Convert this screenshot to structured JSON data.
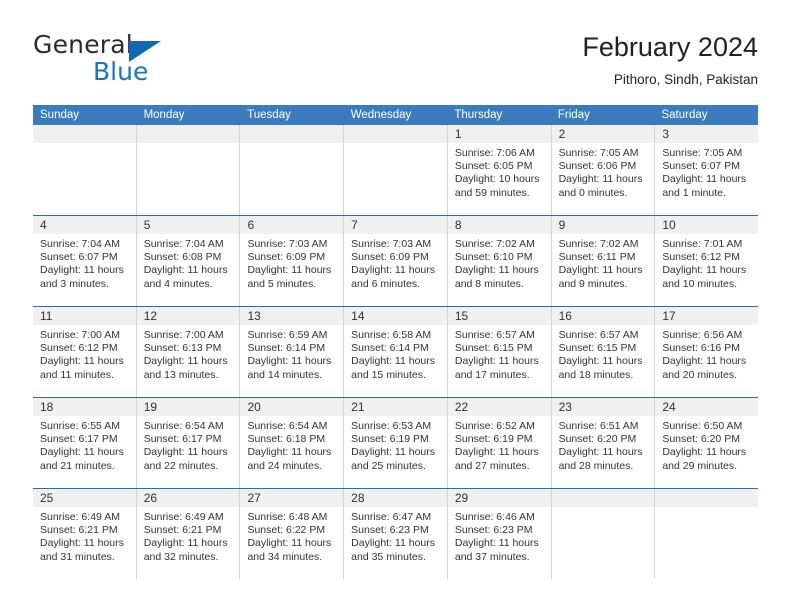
{
  "logo": {
    "word_top": "General",
    "word_bottom": "Blue",
    "triangle_color": "#1268b3",
    "blue_color": "#1b75bb"
  },
  "header": {
    "title": "February 2024",
    "location": "Pithoro, Sindh, Pakistan"
  },
  "theme": {
    "header_blue": "#3a7cbe",
    "rule_blue": "#2e6da4",
    "daynum_band": "#f0f0f0",
    "cell_border": "#d4d4d4"
  },
  "calendar": {
    "weekday_headers": [
      "Sunday",
      "Monday",
      "Tuesday",
      "Wednesday",
      "Thursday",
      "Friday",
      "Saturday"
    ],
    "weeks": [
      [
        {
          "day": "",
          "sunrise": "",
          "sunset": "",
          "daylight_line1": "",
          "daylight_line2": ""
        },
        {
          "day": "",
          "sunrise": "",
          "sunset": "",
          "daylight_line1": "",
          "daylight_line2": ""
        },
        {
          "day": "",
          "sunrise": "",
          "sunset": "",
          "daylight_line1": "",
          "daylight_line2": ""
        },
        {
          "day": "",
          "sunrise": "",
          "sunset": "",
          "daylight_line1": "",
          "daylight_line2": ""
        },
        {
          "day": "1",
          "sunrise": "Sunrise: 7:06 AM",
          "sunset": "Sunset: 6:05 PM",
          "daylight_line1": "Daylight: 10 hours",
          "daylight_line2": "and 59 minutes."
        },
        {
          "day": "2",
          "sunrise": "Sunrise: 7:05 AM",
          "sunset": "Sunset: 6:06 PM",
          "daylight_line1": "Daylight: 11 hours",
          "daylight_line2": "and 0 minutes."
        },
        {
          "day": "3",
          "sunrise": "Sunrise: 7:05 AM",
          "sunset": "Sunset: 6:07 PM",
          "daylight_line1": "Daylight: 11 hours",
          "daylight_line2": "and 1 minute."
        }
      ],
      [
        {
          "day": "4",
          "sunrise": "Sunrise: 7:04 AM",
          "sunset": "Sunset: 6:07 PM",
          "daylight_line1": "Daylight: 11 hours",
          "daylight_line2": "and 3 minutes."
        },
        {
          "day": "5",
          "sunrise": "Sunrise: 7:04 AM",
          "sunset": "Sunset: 6:08 PM",
          "daylight_line1": "Daylight: 11 hours",
          "daylight_line2": "and 4 minutes."
        },
        {
          "day": "6",
          "sunrise": "Sunrise: 7:03 AM",
          "sunset": "Sunset: 6:09 PM",
          "daylight_line1": "Daylight: 11 hours",
          "daylight_line2": "and 5 minutes."
        },
        {
          "day": "7",
          "sunrise": "Sunrise: 7:03 AM",
          "sunset": "Sunset: 6:09 PM",
          "daylight_line1": "Daylight: 11 hours",
          "daylight_line2": "and 6 minutes."
        },
        {
          "day": "8",
          "sunrise": "Sunrise: 7:02 AM",
          "sunset": "Sunset: 6:10 PM",
          "daylight_line1": "Daylight: 11 hours",
          "daylight_line2": "and 8 minutes."
        },
        {
          "day": "9",
          "sunrise": "Sunrise: 7:02 AM",
          "sunset": "Sunset: 6:11 PM",
          "daylight_line1": "Daylight: 11 hours",
          "daylight_line2": "and 9 minutes."
        },
        {
          "day": "10",
          "sunrise": "Sunrise: 7:01 AM",
          "sunset": "Sunset: 6:12 PM",
          "daylight_line1": "Daylight: 11 hours",
          "daylight_line2": "and 10 minutes."
        }
      ],
      [
        {
          "day": "11",
          "sunrise": "Sunrise: 7:00 AM",
          "sunset": "Sunset: 6:12 PM",
          "daylight_line1": "Daylight: 11 hours",
          "daylight_line2": "and 11 minutes."
        },
        {
          "day": "12",
          "sunrise": "Sunrise: 7:00 AM",
          "sunset": "Sunset: 6:13 PM",
          "daylight_line1": "Daylight: 11 hours",
          "daylight_line2": "and 13 minutes."
        },
        {
          "day": "13",
          "sunrise": "Sunrise: 6:59 AM",
          "sunset": "Sunset: 6:14 PM",
          "daylight_line1": "Daylight: 11 hours",
          "daylight_line2": "and 14 minutes."
        },
        {
          "day": "14",
          "sunrise": "Sunrise: 6:58 AM",
          "sunset": "Sunset: 6:14 PM",
          "daylight_line1": "Daylight: 11 hours",
          "daylight_line2": "and 15 minutes."
        },
        {
          "day": "15",
          "sunrise": "Sunrise: 6:57 AM",
          "sunset": "Sunset: 6:15 PM",
          "daylight_line1": "Daylight: 11 hours",
          "daylight_line2": "and 17 minutes."
        },
        {
          "day": "16",
          "sunrise": "Sunrise: 6:57 AM",
          "sunset": "Sunset: 6:15 PM",
          "daylight_line1": "Daylight: 11 hours",
          "daylight_line2": "and 18 minutes."
        },
        {
          "day": "17",
          "sunrise": "Sunrise: 6:56 AM",
          "sunset": "Sunset: 6:16 PM",
          "daylight_line1": "Daylight: 11 hours",
          "daylight_line2": "and 20 minutes."
        }
      ],
      [
        {
          "day": "18",
          "sunrise": "Sunrise: 6:55 AM",
          "sunset": "Sunset: 6:17 PM",
          "daylight_line1": "Daylight: 11 hours",
          "daylight_line2": "and 21 minutes."
        },
        {
          "day": "19",
          "sunrise": "Sunrise: 6:54 AM",
          "sunset": "Sunset: 6:17 PM",
          "daylight_line1": "Daylight: 11 hours",
          "daylight_line2": "and 22 minutes."
        },
        {
          "day": "20",
          "sunrise": "Sunrise: 6:54 AM",
          "sunset": "Sunset: 6:18 PM",
          "daylight_line1": "Daylight: 11 hours",
          "daylight_line2": "and 24 minutes."
        },
        {
          "day": "21",
          "sunrise": "Sunrise: 6:53 AM",
          "sunset": "Sunset: 6:19 PM",
          "daylight_line1": "Daylight: 11 hours",
          "daylight_line2": "and 25 minutes."
        },
        {
          "day": "22",
          "sunrise": "Sunrise: 6:52 AM",
          "sunset": "Sunset: 6:19 PM",
          "daylight_line1": "Daylight: 11 hours",
          "daylight_line2": "and 27 minutes."
        },
        {
          "day": "23",
          "sunrise": "Sunrise: 6:51 AM",
          "sunset": "Sunset: 6:20 PM",
          "daylight_line1": "Daylight: 11 hours",
          "daylight_line2": "and 28 minutes."
        },
        {
          "day": "24",
          "sunrise": "Sunrise: 6:50 AM",
          "sunset": "Sunset: 6:20 PM",
          "daylight_line1": "Daylight: 11 hours",
          "daylight_line2": "and 29 minutes."
        }
      ],
      [
        {
          "day": "25",
          "sunrise": "Sunrise: 6:49 AM",
          "sunset": "Sunset: 6:21 PM",
          "daylight_line1": "Daylight: 11 hours",
          "daylight_line2": "and 31 minutes."
        },
        {
          "day": "26",
          "sunrise": "Sunrise: 6:49 AM",
          "sunset": "Sunset: 6:21 PM",
          "daylight_line1": "Daylight: 11 hours",
          "daylight_line2": "and 32 minutes."
        },
        {
          "day": "27",
          "sunrise": "Sunrise: 6:48 AM",
          "sunset": "Sunset: 6:22 PM",
          "daylight_line1": "Daylight: 11 hours",
          "daylight_line2": "and 34 minutes."
        },
        {
          "day": "28",
          "sunrise": "Sunrise: 6:47 AM",
          "sunset": "Sunset: 6:23 PM",
          "daylight_line1": "Daylight: 11 hours",
          "daylight_line2": "and 35 minutes."
        },
        {
          "day": "29",
          "sunrise": "Sunrise: 6:46 AM",
          "sunset": "Sunset: 6:23 PM",
          "daylight_line1": "Daylight: 11 hours",
          "daylight_line2": "and 37 minutes."
        },
        {
          "day": "",
          "sunrise": "",
          "sunset": "",
          "daylight_line1": "",
          "daylight_line2": ""
        },
        {
          "day": "",
          "sunrise": "",
          "sunset": "",
          "daylight_line1": "",
          "daylight_line2": ""
        }
      ]
    ]
  }
}
